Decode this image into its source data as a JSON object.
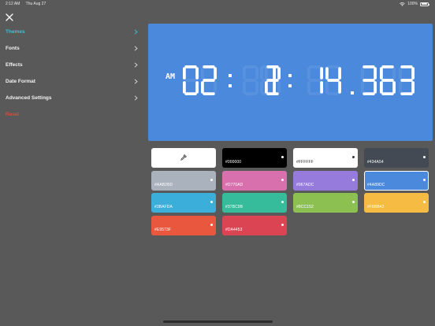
{
  "status_bar": {
    "time": "2:12 AM",
    "date": "Thu Aug 27",
    "battery": "100%"
  },
  "menu": {
    "items": [
      {
        "label": "Themes",
        "key": "themes"
      },
      {
        "label": "Fonts",
        "key": "fonts"
      },
      {
        "label": "Effects",
        "key": "effects"
      },
      {
        "label": "Date Format",
        "key": "date-format"
      },
      {
        "label": "Advanced Settings",
        "key": "advanced-settings"
      }
    ],
    "reset_label": "Reset"
  },
  "clock": {
    "ampm": "AM",
    "hours": "02",
    "minutes": "12",
    "seconds": "14.363",
    "background": "#4A89DC",
    "digit_color": "#FFFFFF"
  },
  "swatches": [
    {
      "hex": "",
      "color": "#FFFFFF",
      "text_color": "#333333",
      "custom": true
    },
    {
      "hex": "#000000",
      "color": "#000000",
      "text_color": "#FFFFFF"
    },
    {
      "hex": "#FFFFFF",
      "color": "#FFFFFF",
      "text_color": "#333333"
    },
    {
      "hex": "#434A54",
      "color": "#434A54",
      "text_color": "#FFFFFF"
    },
    {
      "hex": "#AAB2BD",
      "color": "#AAB2BD",
      "text_color": "#FFFFFF"
    },
    {
      "hex": "#D770AD",
      "color": "#D770AD",
      "text_color": "#FFFFFF"
    },
    {
      "hex": "#967ADC",
      "color": "#967ADC",
      "text_color": "#FFFFFF"
    },
    {
      "hex": "#4A89DC",
      "color": "#4A89DC",
      "text_color": "#FFFFFF",
      "selected": true
    },
    {
      "hex": "#3BAFDA",
      "color": "#3BAFDA",
      "text_color": "#FFFFFF"
    },
    {
      "hex": "#37BC9B",
      "color": "#37BC9B",
      "text_color": "#FFFFFF"
    },
    {
      "hex": "#8CC152",
      "color": "#8CC152",
      "text_color": "#FFFFFF"
    },
    {
      "hex": "#F6BB42",
      "color": "#F6BB42",
      "text_color": "#FFFFFF"
    },
    {
      "hex": "#E9573F",
      "color": "#E9573F",
      "text_color": "#FFFFFF"
    },
    {
      "hex": "#DA4453",
      "color": "#DA4453",
      "text_color": "#FFFFFF"
    }
  ],
  "colors": {
    "background": "#595959",
    "active_menu": "#35C6D6",
    "reset": "#FF4A3D"
  }
}
